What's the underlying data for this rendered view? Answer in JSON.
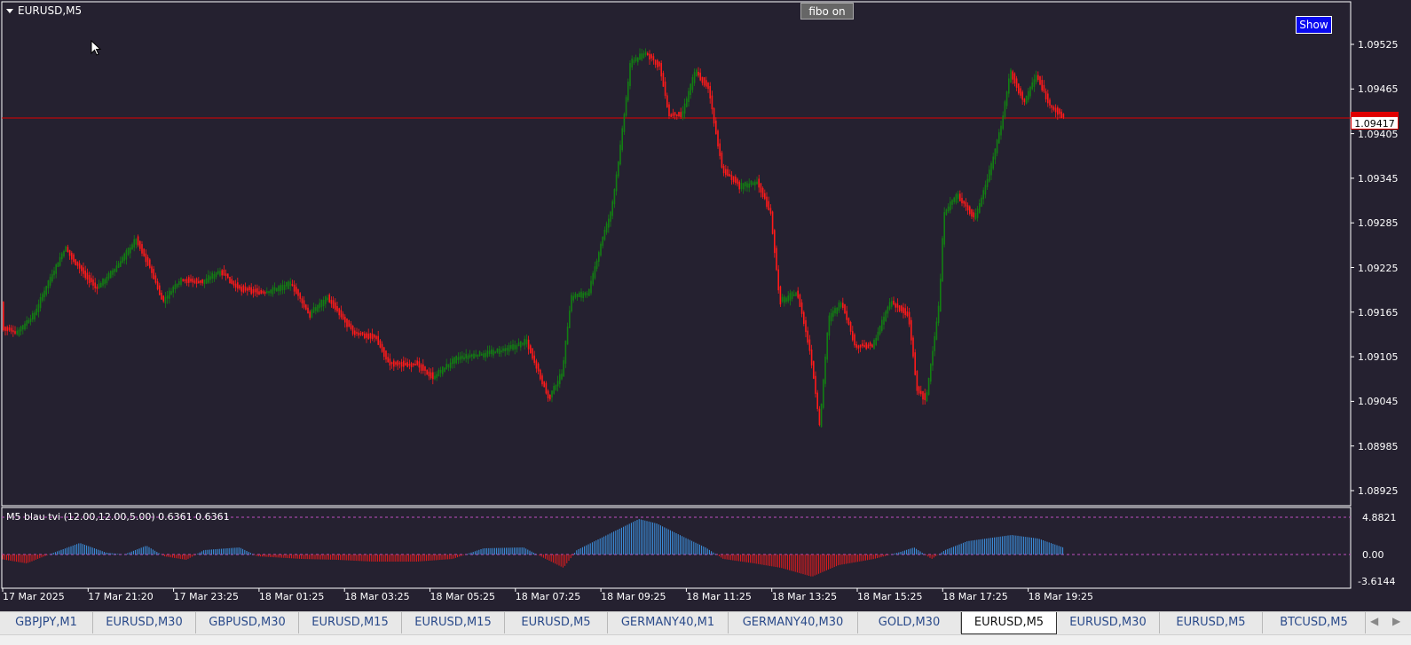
{
  "chart": {
    "title": "EURUSD,M5",
    "fibo_button": "fibo on",
    "show_button": "Show",
    "current_price": "1.09417",
    "price_labels": [
      "1.09525",
      "1.09465",
      "1.09405",
      "1.09345",
      "1.09285",
      "1.09225",
      "1.09165",
      "1.09105",
      "1.09045",
      "1.08985",
      "1.08925"
    ],
    "time_labels": [
      "17 Mar 2025",
      "17 Mar 21:20",
      "17 Mar 23:25",
      "18 Mar 01:25",
      "18 Mar 03:25",
      "18 Mar 05:25",
      "18 Mar 07:25",
      "18 Mar 09:25",
      "18 Mar 11:25",
      "18 Mar 13:25",
      "18 Mar 15:25",
      "18 Mar 17:25",
      "18 Mar 19:25"
    ],
    "colors": {
      "bull": "#137f13",
      "bear": "#ff1a1a",
      "background": "#252130",
      "grid_line": "#e00000",
      "osc_pos": "#3d96e8",
      "osc_neg": "#e81c1c"
    }
  },
  "indicator": {
    "label": "M5  blau tvi (12.00,12.00,5.00)  0.6361  0.6361",
    "upper_label": "4.8821",
    "zero_label": "0.00",
    "lower_label": "-3.6144"
  },
  "tabs": [
    {
      "label": "GBPJPY,M1",
      "active": false
    },
    {
      "label": "EURUSD,M30",
      "active": false
    },
    {
      "label": "GBPUSD,M30",
      "active": false
    },
    {
      "label": "EURUSD,M15",
      "active": false
    },
    {
      "label": "EURUSD,M15",
      "active": false
    },
    {
      "label": "EURUSD,M5",
      "active": false
    },
    {
      "label": "GERMANY40,M1",
      "active": false
    },
    {
      "label": "GERMANY40,M30",
      "active": false
    },
    {
      "label": "GOLD,M30",
      "active": false
    },
    {
      "label": "EURUSD,M5",
      "active": true
    },
    {
      "label": "EURUSD,M30",
      "active": false
    },
    {
      "label": "EURUSD,M5",
      "active": false
    },
    {
      "label": "BTCUSD,M5",
      "active": false
    }
  ],
  "tab_nav": {
    "left": "◀",
    "right": "▶"
  }
}
